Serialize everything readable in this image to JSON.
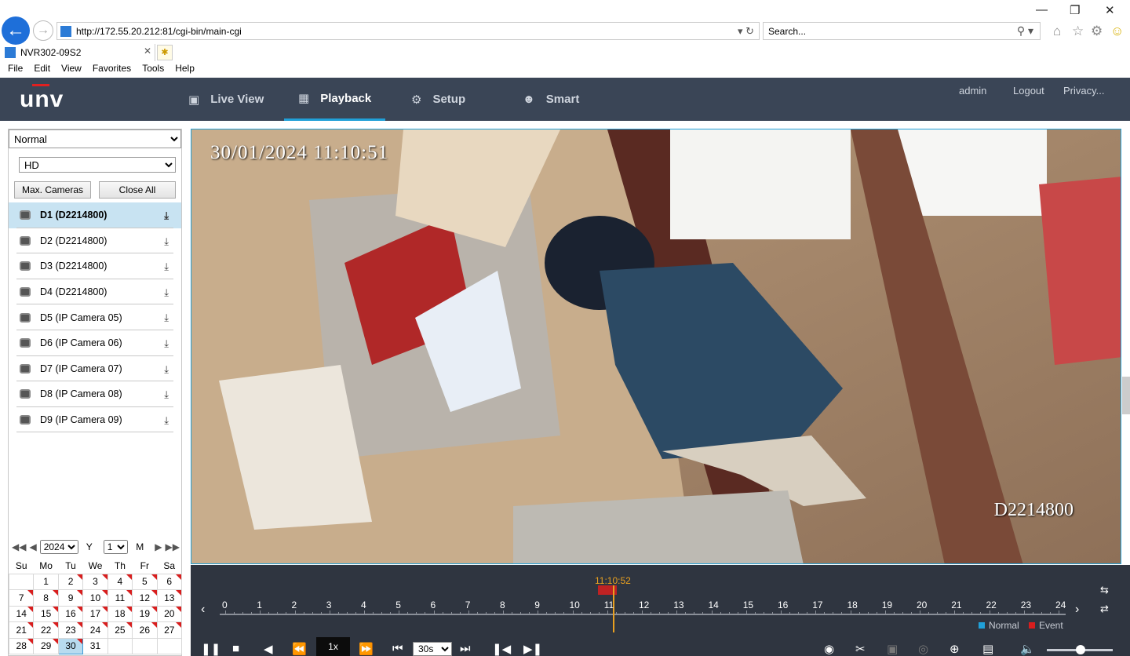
{
  "browser": {
    "url": "http://172.55.20.212:81/cgi-bin/main-cgi",
    "search_placeholder": "Search...",
    "tab_title": "NVR302-09S2",
    "menu": [
      "File",
      "Edit",
      "View",
      "Favorites",
      "Tools",
      "Help"
    ]
  },
  "header": {
    "logo": "unv",
    "nav": [
      {
        "label": "Live View",
        "icon": "monitor-icon"
      },
      {
        "label": "Playback",
        "icon": "film-icon",
        "active": true
      },
      {
        "label": "Setup",
        "icon": "gear-icon"
      },
      {
        "label": "Smart",
        "icon": "person-scan-icon"
      }
    ],
    "user": "admin",
    "logout": "Logout",
    "privacy": "Privacy..."
  },
  "sidebar": {
    "mode_select": "Normal",
    "stream_select": "HD",
    "max_cameras": "Max. Cameras",
    "close_all": "Close All",
    "cameras": [
      {
        "label": "D1 (D2214800)",
        "selected": true
      },
      {
        "label": "D2 (D2214800)"
      },
      {
        "label": "D3 (D2214800)"
      },
      {
        "label": "D4 (D2214800)"
      },
      {
        "label": "D5 (IP Camera 05)"
      },
      {
        "label": "D6 (IP Camera 06)"
      },
      {
        "label": "D7 (IP Camera 07)"
      },
      {
        "label": "D8 (IP Camera 08)"
      },
      {
        "label": "D9 (IP Camera 09)"
      }
    ]
  },
  "calendar": {
    "year": "2024",
    "year_label": "Y",
    "month": "1",
    "month_label": "M",
    "weekdays": [
      "Su",
      "Mo",
      "Tu",
      "We",
      "Th",
      "Fr",
      "Sa"
    ],
    "weeks": [
      [
        "",
        "1",
        "2",
        "3",
        "4",
        "5",
        "6"
      ],
      [
        "7",
        "8",
        "9",
        "10",
        "11",
        "12",
        "13"
      ],
      [
        "14",
        "15",
        "16",
        "17",
        "18",
        "19",
        "20"
      ],
      [
        "21",
        "22",
        "23",
        "24",
        "25",
        "26",
        "27"
      ],
      [
        "28",
        "29",
        "30",
        "31",
        "",
        "",
        ""
      ]
    ],
    "recorded_days": [
      "2",
      "3",
      "4",
      "5",
      "6",
      "7",
      "8",
      "9",
      "10",
      "11",
      "12",
      "13",
      "14",
      "15",
      "16",
      "17",
      "18",
      "19",
      "20",
      "21",
      "22",
      "23",
      "24",
      "25",
      "26",
      "27",
      "28",
      "29",
      "30"
    ],
    "selected_day": "30"
  },
  "video": {
    "osd_time": "30/01/2024  11:10:51",
    "osd_camera": "D2214800"
  },
  "timeline": {
    "current_time": "11:10:52",
    "hours": [
      "0",
      "1",
      "2",
      "3",
      "4",
      "5",
      "6",
      "7",
      "8",
      "9",
      "10",
      "11",
      "12",
      "13",
      "14",
      "15",
      "16",
      "17",
      "18",
      "19",
      "20",
      "21",
      "22",
      "23",
      "24"
    ],
    "legend_normal": "Normal",
    "legend_event": "Event",
    "normal_color": "#20a0d8",
    "event_color": "#d81e1e",
    "speed": "1x",
    "step": "30s"
  }
}
